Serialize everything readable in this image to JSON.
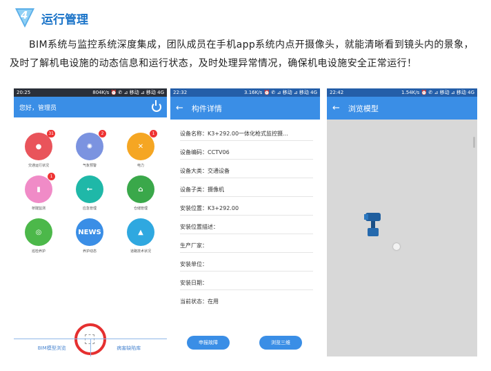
{
  "header": {
    "badge_number": "4",
    "title": "运行管理"
  },
  "paragraph": "BIM系统与监控系统深度集成，团队成员在手机app系统内点开摄像头，就能清晰看到镜头内的景象，及时了解机电设施的动态信息和运行状态，及时处理异常情况，确保机电设施安全正常运行！",
  "phone1": {
    "status_time": "20:25",
    "status_right": "804K/s ⏰ ✆ ⊿ 移动 ⊿ 移动 4G",
    "greeting": "您好，管理员",
    "tiles": [
      {
        "label": "交通运行状况",
        "badge": "31",
        "color": "#e9545b",
        "icon": "traffic-light-icon"
      },
      {
        "label": "气象预警",
        "badge": "2",
        "color": "#7b93e0",
        "icon": "siren-icon"
      },
      {
        "label": "电力",
        "badge": "1",
        "color": "#f5a623",
        "icon": "power-tower-icon"
      },
      {
        "label": "桥隧监测",
        "badge": "1",
        "color": "#f08bc7",
        "icon": "tower-icon"
      },
      {
        "label": "应急管理",
        "badge": "",
        "color": "#1fb8a8",
        "icon": "arrow-sign-icon"
      },
      {
        "label": "仓储管理",
        "badge": "",
        "color": "#3aa84a",
        "icon": "warehouse-icon"
      },
      {
        "label": "巡检养护",
        "badge": "",
        "color": "#4cb84a",
        "icon": "target-icon"
      },
      {
        "label": "养护动态",
        "badge": "",
        "color": "#3a8ee6",
        "icon": "news-icon"
      },
      {
        "label": "道路技术状况",
        "badge": "",
        "color": "#2fa8e0",
        "icon": "road-icon"
      }
    ],
    "bottom_left": "BIM模型浏览",
    "bottom_right": "病害缺陷库"
  },
  "phone2": {
    "status_time": "22:32",
    "status_right": "3.16K/s ⏰ ✆ ⊿ 移动 ⊿ 移动 4G",
    "title": "构件详情",
    "fields": [
      "设备名称：K3+292.00一体化枪式监控摄...",
      "设备编码：CCTV06",
      "设备大类：交通设备",
      "设备子类：摄像机",
      "安装位置：K3+292.00",
      "安装位置描述：",
      "生产厂家：",
      "安装单位：",
      "安装日期：",
      "当前状态：在用"
    ],
    "btn_report": "申报故障",
    "btn_3d": "浏览三维"
  },
  "phone3": {
    "status_time": "22:42",
    "status_right": "1.54K/s ⏰ ✆ ⊿ 移动 ⊿ 移动 4G",
    "title": "浏览模型"
  }
}
